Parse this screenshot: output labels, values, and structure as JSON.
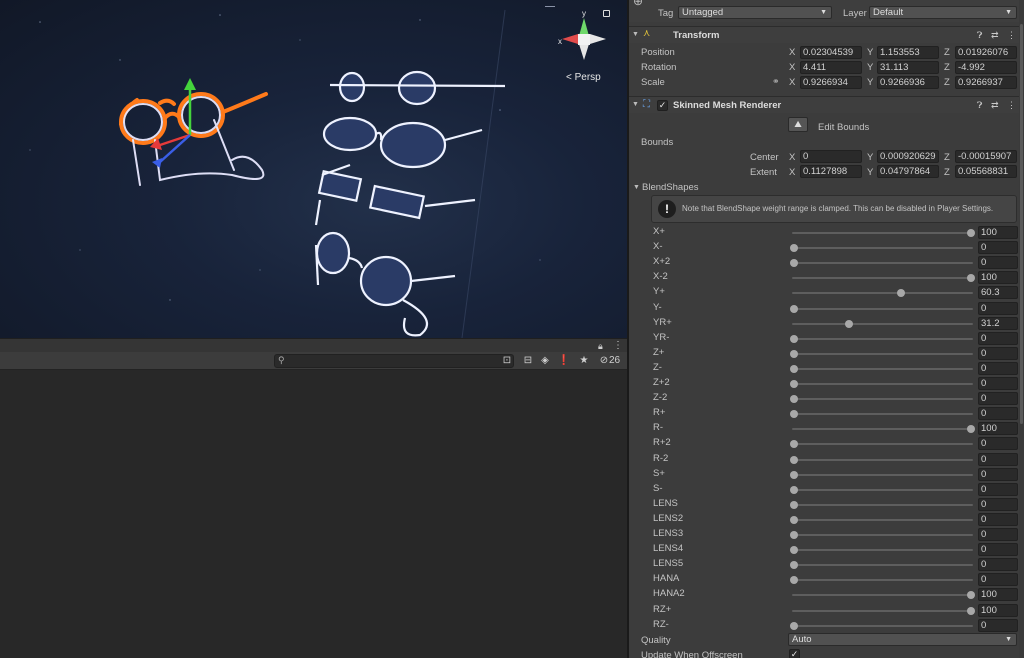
{
  "scene": {
    "persp_label": "Persp",
    "gizmo_y_label": "y",
    "gizmo_x_label": "x"
  },
  "bottom": {
    "search_placeholder": "",
    "count": "26"
  },
  "inspector": {
    "tag_label": "Tag",
    "tag_value": "Untagged",
    "layer_label": "Layer",
    "layer_value": "Default",
    "transform": {
      "title": "Transform",
      "position_label": "Position",
      "rotation_label": "Rotation",
      "scale_label": "Scale",
      "position": {
        "x": "0.02304539",
        "y": "1.153553",
        "z": "0.01926076"
      },
      "rotation": {
        "x": "4.411",
        "y": "31.113",
        "z": "-4.992"
      },
      "scale": {
        "x": "0.9266934",
        "y": "0.9266936",
        "z": "0.9266937"
      }
    },
    "smr": {
      "title": "Skinned Mesh Renderer",
      "edit_bounds_label": "Edit Bounds",
      "bounds_label": "Bounds",
      "center_label": "Center",
      "extent_label": "Extent",
      "center": {
        "x": "0",
        "y": "0.000920629",
        "z": "-0.00015907"
      },
      "extent": {
        "x": "0.1127898",
        "y": "0.04797864",
        "z": "0.05568831"
      },
      "blendshapes_label": "BlendShapes",
      "warning_text": "Note that BlendShape weight range is clamped. This can be disabled in Player Settings.",
      "quality_label": "Quality",
      "quality_value": "Auto",
      "update_offscreen_label": "Update When Offscreen"
    },
    "axis_labels": {
      "x": "X",
      "y": "Y",
      "z": "Z"
    },
    "blendshapes": [
      {
        "name": "X+",
        "value": "100",
        "frac": 1.0
      },
      {
        "name": "X-",
        "value": "0",
        "frac": 0.0
      },
      {
        "name": "X+2",
        "value": "0",
        "frac": 0.0
      },
      {
        "name": "X-2",
        "value": "100",
        "frac": 1.0
      },
      {
        "name": "Y+",
        "value": "60.3",
        "frac": 0.603
      },
      {
        "name": "Y-",
        "value": "0",
        "frac": 0.0
      },
      {
        "name": "YR+",
        "value": "31.2",
        "frac": 0.312
      },
      {
        "name": "YR-",
        "value": "0",
        "frac": 0.0
      },
      {
        "name": "Z+",
        "value": "0",
        "frac": 0.0
      },
      {
        "name": "Z-",
        "value": "0",
        "frac": 0.0
      },
      {
        "name": "Z+2",
        "value": "0",
        "frac": 0.0
      },
      {
        "name": "Z-2",
        "value": "0",
        "frac": 0.0
      },
      {
        "name": "R+",
        "value": "0",
        "frac": 0.0
      },
      {
        "name": "R-",
        "value": "100",
        "frac": 1.0
      },
      {
        "name": "R+2",
        "value": "0",
        "frac": 0.0
      },
      {
        "name": "R-2",
        "value": "0",
        "frac": 0.0
      },
      {
        "name": "S+",
        "value": "0",
        "frac": 0.0
      },
      {
        "name": "S-",
        "value": "0",
        "frac": 0.0
      },
      {
        "name": "LENS",
        "value": "0",
        "frac": 0.0
      },
      {
        "name": "LENS2",
        "value": "0",
        "frac": 0.0
      },
      {
        "name": "LENS3",
        "value": "0",
        "frac": 0.0
      },
      {
        "name": "LENS4",
        "value": "0",
        "frac": 0.0
      },
      {
        "name": "LENS5",
        "value": "0",
        "frac": 0.0
      },
      {
        "name": "HANA",
        "value": "0",
        "frac": 0.0
      },
      {
        "name": "HANA2",
        "value": "100",
        "frac": 1.0
      },
      {
        "name": "RZ+",
        "value": "100",
        "frac": 1.0
      },
      {
        "name": "RZ-",
        "value": "0",
        "frac": 0.0
      }
    ]
  }
}
